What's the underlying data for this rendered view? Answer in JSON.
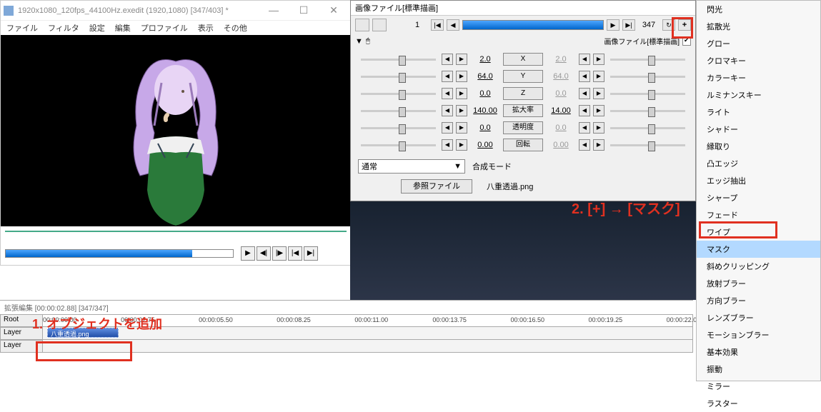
{
  "main": {
    "title": "1920x1080_120fps_44100Hz.exedit (1920,1080) [347/403] *",
    "menu": [
      "ファイル",
      "フィルタ",
      "設定",
      "編集",
      "プロファイル",
      "表示",
      "その他"
    ]
  },
  "timeline": {
    "header": "拡張編集 [00:00:02.88] [347/347]",
    "root_label": "Root",
    "layers": [
      "Layer",
      "Layer"
    ],
    "ticks": [
      "00:00:00.00",
      "00:00:02.75",
      "00:00:05.50",
      "00:00:08.25",
      "00:00:11.00",
      "00:00:13.75",
      "00:00:16.50",
      "00:00:19.25",
      "00:00:22.00"
    ],
    "clip_label": "八重透過.png"
  },
  "obj": {
    "title": "画像ファイル[標準描画]",
    "frame_in": "1",
    "frame_out": "347",
    "sub_label": "画像ファイル[標準描画]",
    "params": [
      {
        "name": "X",
        "l": "2.0",
        "r": "2.0"
      },
      {
        "name": "Y",
        "l": "64.0",
        "r": "64.0"
      },
      {
        "name": "Z",
        "l": "0.0",
        "r": "0.0"
      },
      {
        "name": "拡大率",
        "l": "140.00",
        "r": "14.00"
      },
      {
        "name": "透明度",
        "l": "0.0",
        "r": "0.0"
      },
      {
        "name": "回転",
        "l": "0.00",
        "r": "0.00"
      }
    ],
    "mode_label": "合成モード",
    "mode_value": "通常",
    "ref_btn": "参照ファイル",
    "ref_value": "八重透過.png"
  },
  "effects": [
    "閃光",
    "拡散光",
    "グロー",
    "クロマキー",
    "カラーキー",
    "ルミナンスキー",
    "ライト",
    "シャドー",
    "縁取り",
    "凸エッジ",
    "エッジ抽出",
    "シャープ",
    "フェード",
    "ワイプ",
    "マスク",
    "斜めクリッピング",
    "放射ブラー",
    "方向ブラー",
    "レンズブラー",
    "モーションブラー",
    "基本効果",
    "振動",
    "ミラー",
    "ラスター"
  ],
  "effects_selected": "マスク",
  "annot": {
    "a1": "1. オブジェクトを追加",
    "a2": "2. [+] → [マスク]"
  }
}
